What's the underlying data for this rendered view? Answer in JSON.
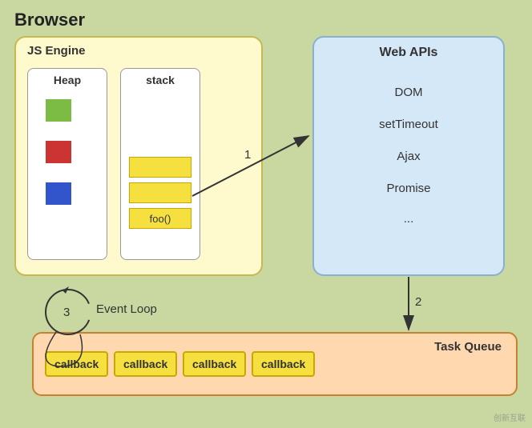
{
  "browser": {
    "title": "Browser"
  },
  "js_engine": {
    "label": "JS Engine",
    "heap": {
      "label": "Heap",
      "colors": [
        "#7cbb44",
        "#cc3333",
        "#3355cc"
      ]
    },
    "stack": {
      "label": "stack",
      "foo_label": "foo()"
    }
  },
  "web_apis": {
    "label": "Web APIs",
    "items": [
      "DOM",
      "setTimeout",
      "Ajax",
      "Promise",
      "..."
    ]
  },
  "task_queue": {
    "label": "Task Queue",
    "callbacks": [
      "callback",
      "callback",
      "callback",
      "callback"
    ]
  },
  "event_loop": {
    "label": "Event Loop",
    "number": "3"
  },
  "arrows": {
    "arrow1_label": "1",
    "arrow2_label": "2"
  },
  "watermark": {
    "text": "创新互联"
  }
}
